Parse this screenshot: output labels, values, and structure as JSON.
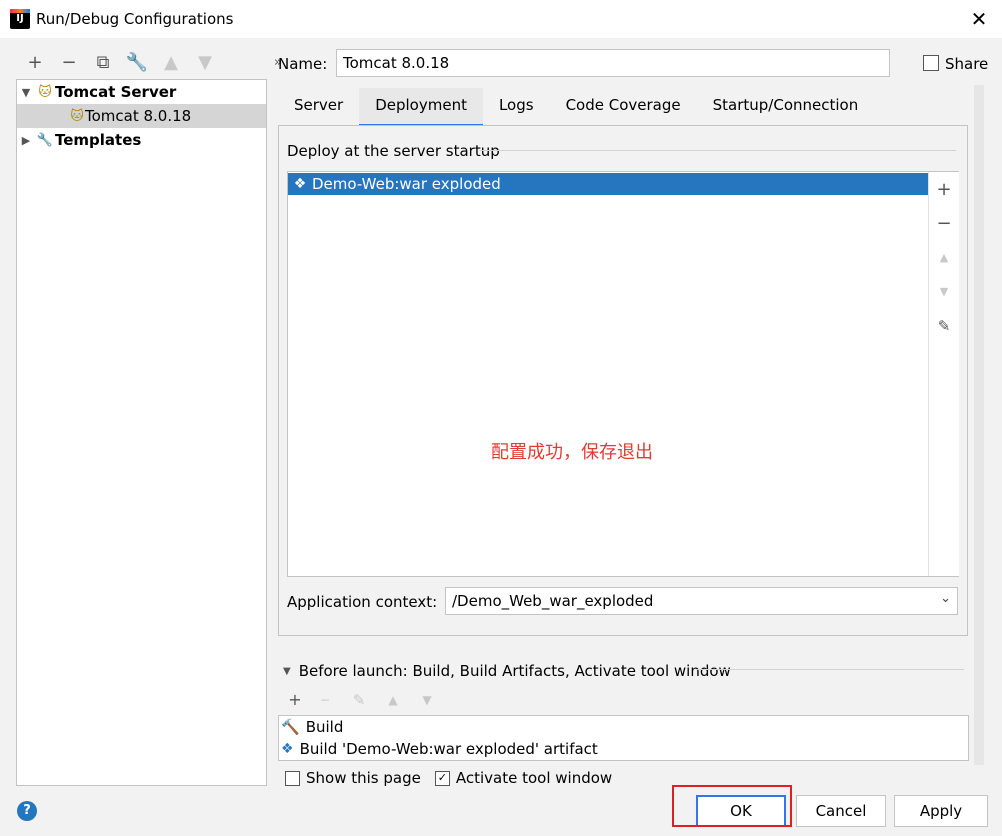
{
  "window": {
    "title": "Run/Debug Configurations",
    "logo_text": "IJ"
  },
  "tree": {
    "root": "Tomcat Server",
    "child": "Tomcat 8.0.18",
    "templates": "Templates"
  },
  "name_field": {
    "label": "Name:",
    "value": "Tomcat 8.0.18"
  },
  "share": {
    "label": "Share",
    "checked": false
  },
  "tabs": [
    {
      "label": "Server"
    },
    {
      "label": "Deployment",
      "active": true
    },
    {
      "label": "Logs"
    },
    {
      "label": "Code Coverage"
    },
    {
      "label": "Startup/Connection"
    }
  ],
  "deployment": {
    "section_title": "Deploy at the server startup",
    "artifacts": [
      "Demo-Web:war exploded"
    ],
    "annotation": "配置成功，保存退出",
    "app_context_label": "Application context:",
    "app_context_value": "/Demo_Web_war_exploded"
  },
  "before_launch": {
    "title": "Before launch: Build, Build Artifacts, Activate tool window",
    "items": [
      "Build",
      "Build 'Demo-Web:war exploded' artifact"
    ]
  },
  "options": {
    "show_page": {
      "label": "Show this page",
      "checked": false
    },
    "activate_tool": {
      "label": "Activate tool window",
      "checked": true
    }
  },
  "buttons": {
    "ok": "OK",
    "cancel": "Cancel",
    "apply": "Apply",
    "help": "?"
  },
  "colors": {
    "accent": "#3574f0",
    "selection": "#2675bf",
    "annotation": "#e03c31",
    "highlight_box": "#e02020"
  }
}
